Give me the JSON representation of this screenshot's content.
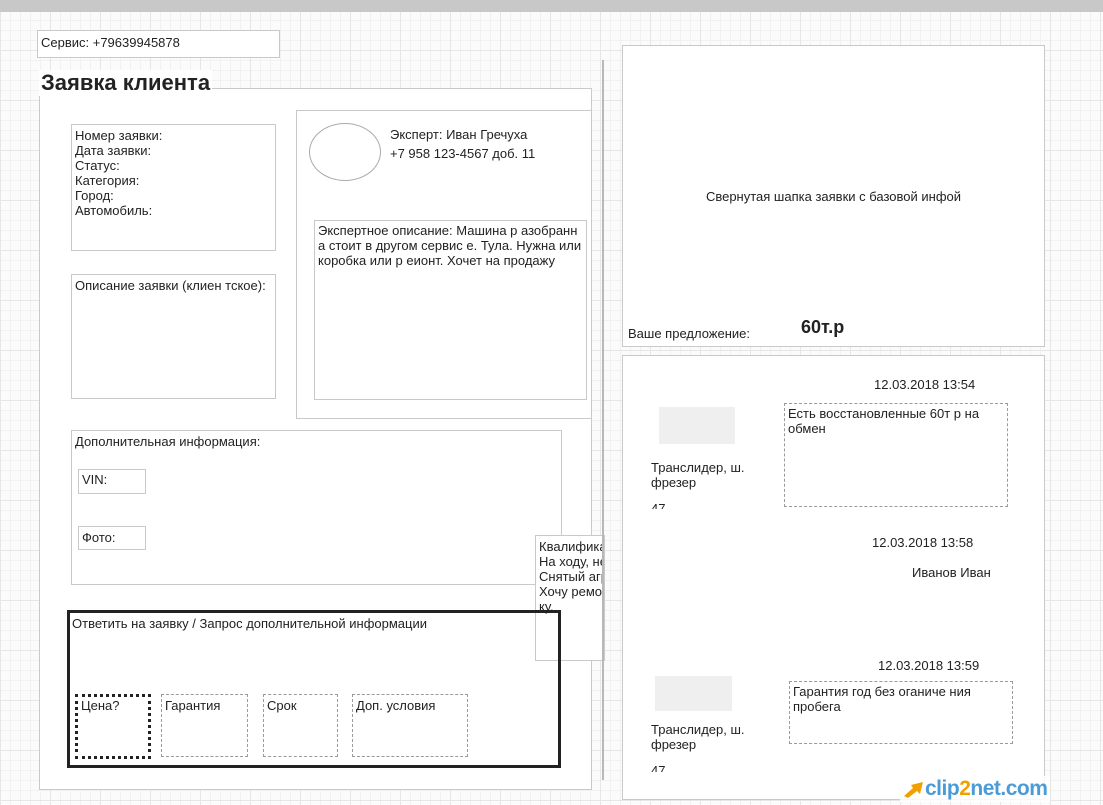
{
  "service": {
    "phone": "Сервис: +79639945878"
  },
  "title": "Заявка клиента",
  "info": {
    "fields": [
      "Номер заявки:",
      "Дата заявки:",
      "Статус:",
      "Категория:",
      "Город:",
      "Автомобиль:"
    ]
  },
  "client_desc": {
    "label": "Описание заявки (клиен тское):"
  },
  "expert": {
    "name": "Эксперт: Иван Гречуха",
    "phone": "+7 958 123-4567 доб. 11",
    "description": "Экспертное описание: Машина р азобранна стоит в другом сервис е. Тула. Нужна или коробка или р еионт. Хочет на продажу"
  },
  "additional": {
    "label": "Дополнительная информация:",
    "vin": "VIN:",
    "photo": "Фото:"
  },
  "qualification": {
    "lines": [
      "Квалифика",
      "На ходу, не",
      "Снятый агр",
      "Хочу ремо",
      "ку."
    ]
  },
  "answer": {
    "label": "Ответить на заявку / Запрос дополнительной информации",
    "buttons": [
      "Цена?",
      "Гарантия",
      "Срок",
      "Доп. условия"
    ]
  },
  "header_collapsed": {
    "text": "Свернутая шапка заявки с базовой инфой",
    "offer_label": "Ваше предложение:",
    "offer_value": "60т.р"
  },
  "chat": {
    "messages": [
      {
        "time": "12.03.2018 13:54",
        "text": "Есть восстановленные 60т р на обмен",
        "sender": "Транслидер, ш. фрезер"
      },
      {
        "time": "12.03.2018 13:58",
        "sender": "Иванов Иван"
      },
      {
        "time": "12.03.2018 13:59",
        "text": "Гарантия год без оганиче ния пробега",
        "sender": "Транслидер, ш. фрезер"
      }
    ],
    "cut_text": "47"
  },
  "watermark": {
    "part1": "clip",
    "part2": "2",
    "part3": "net.com"
  }
}
